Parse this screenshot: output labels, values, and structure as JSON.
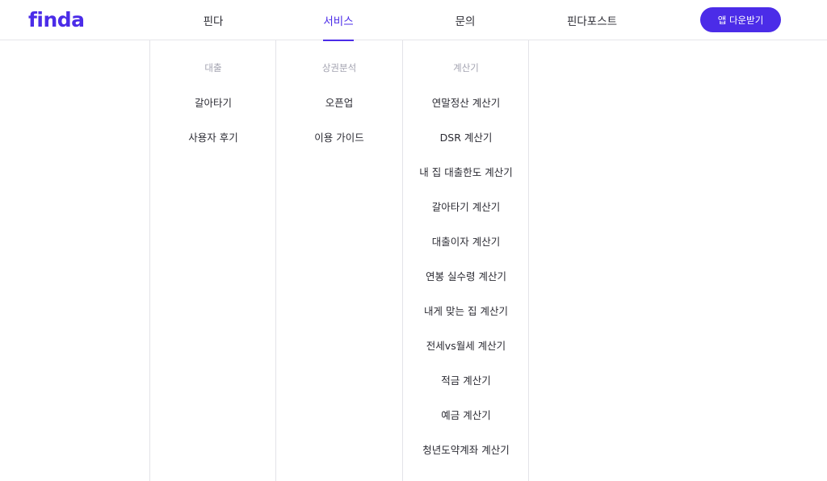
{
  "brand": {
    "logo_text": "finda",
    "accent": "#4b2ce8"
  },
  "nav": {
    "items": [
      {
        "label": "핀다",
        "active": false
      },
      {
        "label": "서비스",
        "active": true
      },
      {
        "label": "문의",
        "active": false
      },
      {
        "label": "핀다포스트",
        "active": false
      }
    ],
    "app_button": "앱 다운받기"
  },
  "menu": {
    "columns": [
      {
        "title": "대출",
        "links": [
          "갈아타기",
          "사용자 후기"
        ]
      },
      {
        "title": "상권분석",
        "links": [
          "오픈업",
          "이용 가이드"
        ]
      },
      {
        "title": "계산기",
        "links": [
          "연말정산 계산기",
          "DSR 계산기",
          "내 집 대출한도 계산기",
          "갈아타기 계산기",
          "대출이자 계산기",
          "연봉 실수령 계산기",
          "내게 맞는 집 계산기",
          "전세vs월세 계산기",
          "적금 계산기",
          "예금 계산기",
          "청년도약계좌 계산기"
        ]
      }
    ]
  }
}
